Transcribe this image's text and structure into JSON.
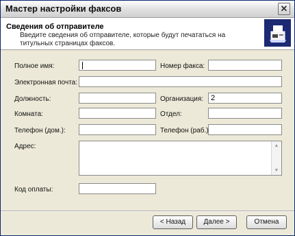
{
  "window": {
    "title": "Мастер настройки факсов",
    "close_glyph": "✕"
  },
  "header": {
    "title": "Сведения об отправителе",
    "subtitle": "Введите сведения об отправителе, которые будут печататься на титульных страницах факсов.",
    "icon": "fax-machine-icon"
  },
  "fields": {
    "full_name": {
      "label": "Полное имя:",
      "value": ""
    },
    "fax_number": {
      "label": "Номер факса:",
      "value": ""
    },
    "email": {
      "label": "Электронная почта:",
      "value": ""
    },
    "position": {
      "label": "Должность:",
      "value": ""
    },
    "organization": {
      "label": "Организация:",
      "value": "2"
    },
    "room": {
      "label": "Комната:",
      "value": ""
    },
    "department": {
      "label": "Отдел:",
      "value": ""
    },
    "home_phone": {
      "label": "Телефон (дом.):",
      "value": ""
    },
    "work_phone": {
      "label": "Телефон (раб.):",
      "value": ""
    },
    "address": {
      "label": "Адрес:",
      "value": ""
    },
    "billing_code": {
      "label": "Код оплаты:",
      "value": ""
    }
  },
  "buttons": {
    "back": "< Назад",
    "next": "Далее >",
    "cancel": "Отмена"
  },
  "colors": {
    "header_icon_bg": "#1c2a73",
    "window_bg": "#ece9d8"
  }
}
